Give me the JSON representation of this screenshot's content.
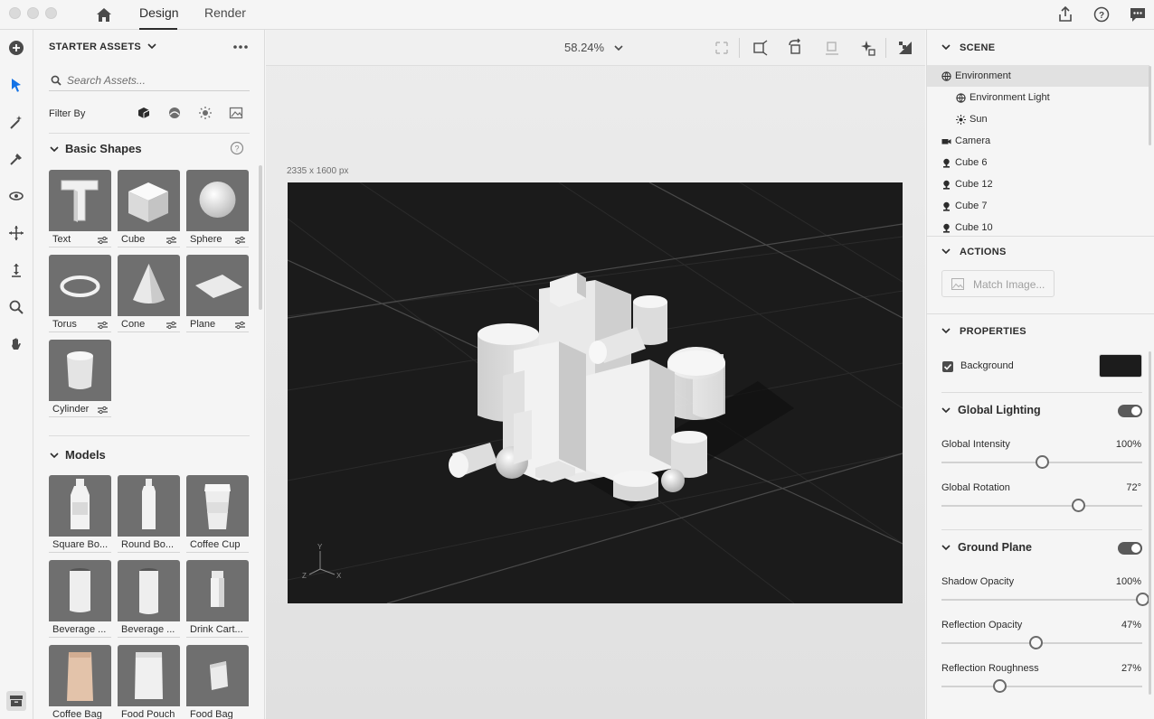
{
  "topbar": {
    "tabs": [
      {
        "label": "Design",
        "active": true
      },
      {
        "label": "Render",
        "active": false
      }
    ],
    "icons": [
      "home-icon",
      "share-icon",
      "help-icon",
      "feedback-icon"
    ]
  },
  "left_tools": [
    "add-icon",
    "select-icon",
    "magic-wand-icon",
    "eyedropper-icon",
    "orbit-icon",
    "pan-icon",
    "dolly-icon",
    "zoom-icon",
    "hand-icon",
    "library-icon"
  ],
  "assets": {
    "title": "STARTER ASSETS",
    "search_placeholder": "Search Assets...",
    "filter_label": "Filter By",
    "basic_shapes": {
      "title": "Basic Shapes",
      "items": [
        "Text",
        "Cube",
        "Sphere",
        "Torus",
        "Cone",
        "Plane",
        "Cylinder"
      ]
    },
    "models": {
      "title": "Models",
      "items": [
        "Square Bo...",
        "Round Bo...",
        "Coffee Cup",
        "Beverage ...",
        "Beverage ...",
        "Drink Cart...",
        "Coffee Bag",
        "Food Pouch",
        "Food Bag"
      ]
    }
  },
  "canvas": {
    "zoom": "58.24%",
    "dimensions": "2335 x 1600 px",
    "axes": {
      "y": "Y",
      "z": "Z",
      "x": "X"
    }
  },
  "right": {
    "scene": {
      "title": "SCENE",
      "items": [
        {
          "label": "Environment",
          "icon": "globe-icon",
          "indent": 0,
          "selected": true
        },
        {
          "label": "Environment Light",
          "icon": "globe-icon",
          "indent": 1,
          "selected": false
        },
        {
          "label": "Sun",
          "icon": "sun-icon",
          "indent": 1,
          "selected": false
        },
        {
          "label": "Camera",
          "icon": "camera-icon",
          "indent": 0,
          "selected": false
        },
        {
          "label": "Cube 6",
          "icon": "object-icon",
          "indent": 0,
          "selected": false
        },
        {
          "label": "Cube 12",
          "icon": "object-icon",
          "indent": 0,
          "selected": false
        },
        {
          "label": "Cube 7",
          "icon": "object-icon",
          "indent": 0,
          "selected": false
        },
        {
          "label": "Cube 10",
          "icon": "object-icon",
          "indent": 0,
          "selected": false
        }
      ]
    },
    "actions": {
      "title": "ACTIONS",
      "match_image": "Match Image..."
    },
    "properties": {
      "title": "PROPERTIES",
      "background_label": "Background",
      "background_color": "#1c1c1c",
      "global_lighting": {
        "title": "Global Lighting",
        "enabled": true,
        "intensity_label": "Global Intensity",
        "intensity_value": "100%",
        "intensity_pos": 0.5,
        "rotation_label": "Global Rotation",
        "rotation_value": "72°",
        "rotation_pos": 0.68
      },
      "ground_plane": {
        "title": "Ground Plane",
        "enabled": true,
        "shadow_label": "Shadow Opacity",
        "shadow_value": "100%",
        "shadow_pos": 1.0,
        "reflection_label": "Reflection Opacity",
        "reflection_value": "47%",
        "reflection_pos": 0.47,
        "roughness_label": "Reflection Roughness",
        "roughness_value": "27%",
        "roughness_pos": 0.29
      }
    }
  }
}
